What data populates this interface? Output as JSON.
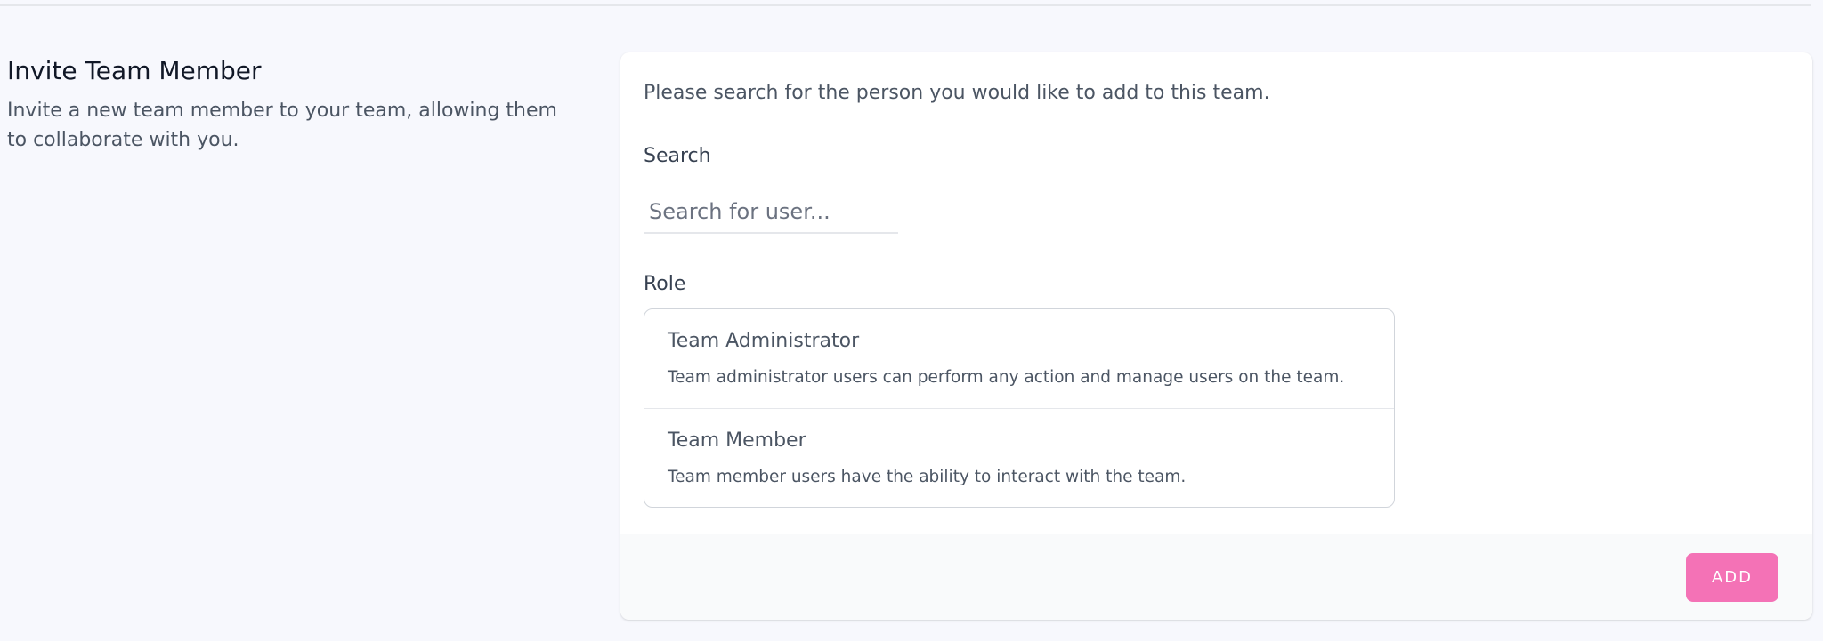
{
  "section": {
    "title": "Invite Team Member",
    "description": "Invite a new team member to your team, allowing them to collaborate with you."
  },
  "form": {
    "intro": "Please search for the person you would like to add to this team.",
    "search": {
      "label": "Search",
      "placeholder": "Search for user...",
      "value": ""
    },
    "role": {
      "label": "Role",
      "options": [
        {
          "name": "Team Administrator",
          "description": "Team administrator users can perform any action and manage users on the team."
        },
        {
          "name": "Team Member",
          "description": "Team member users have the ability to interact with the team."
        }
      ]
    },
    "add_label": "Add"
  },
  "colors": {
    "background": "#f7f8fd",
    "card": "#ffffff",
    "footer": "#f9fafb",
    "accent": "#f472b6"
  }
}
